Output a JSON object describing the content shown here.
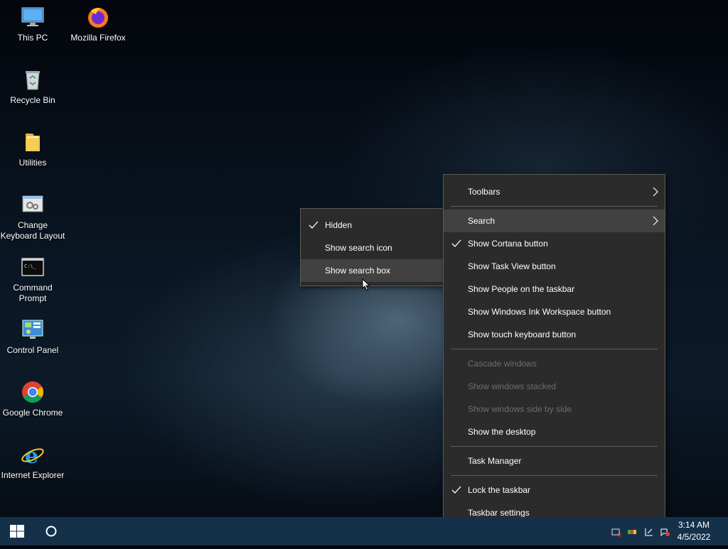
{
  "desktop": {
    "icons": [
      {
        "label_line1": "This PC",
        "label_line2": "",
        "icon": "this-pc-icon"
      },
      {
        "label_line1": "Mozilla Firefox",
        "label_line2": "",
        "icon": "firefox-icon"
      },
      {
        "label_line1": "Recycle Bin",
        "label_line2": "",
        "icon": "recycle-bin-icon"
      },
      {
        "label_line1": "Utilities",
        "label_line2": "",
        "icon": "folder-icon"
      },
      {
        "label_line1": "Change",
        "label_line2": "Keyboard Layout",
        "icon": "keyboard-layout-icon"
      },
      {
        "label_line1": "Command",
        "label_line2": "Prompt",
        "icon": "command-prompt-icon"
      },
      {
        "label_line1": "Control Panel",
        "label_line2": "",
        "icon": "control-panel-icon"
      },
      {
        "label_line1": "Google Chrome",
        "label_line2": "",
        "icon": "chrome-icon"
      },
      {
        "label_line1": "Internet Explorer",
        "label_line2": "",
        "icon": "internet-explorer-icon"
      }
    ]
  },
  "taskbar_menu": {
    "items": [
      {
        "label": "Toolbars",
        "checked": false,
        "submenu": true,
        "disabled": false
      },
      {
        "label": "Search",
        "checked": false,
        "submenu": true,
        "disabled": false,
        "highlighted": true
      },
      {
        "label": "Show Cortana button",
        "checked": true,
        "submenu": false,
        "disabled": false
      },
      {
        "label": "Show Task View button",
        "checked": false,
        "submenu": false,
        "disabled": false
      },
      {
        "label": "Show People on the taskbar",
        "checked": false,
        "submenu": false,
        "disabled": false
      },
      {
        "label": "Show Windows Ink Workspace button",
        "checked": false,
        "submenu": false,
        "disabled": false
      },
      {
        "label": "Show touch keyboard button",
        "checked": false,
        "submenu": false,
        "disabled": false
      },
      {
        "label": "Cascade windows",
        "checked": false,
        "submenu": false,
        "disabled": true
      },
      {
        "label": "Show windows stacked",
        "checked": false,
        "submenu": false,
        "disabled": true
      },
      {
        "label": "Show windows side by side",
        "checked": false,
        "submenu": false,
        "disabled": true
      },
      {
        "label": "Show the desktop",
        "checked": false,
        "submenu": false,
        "disabled": false
      },
      {
        "label": "Task Manager",
        "checked": false,
        "submenu": false,
        "disabled": false
      },
      {
        "label": "Lock the taskbar",
        "checked": true,
        "submenu": false,
        "disabled": false
      },
      {
        "label": "Taskbar settings",
        "checked": false,
        "submenu": false,
        "disabled": false
      }
    ]
  },
  "search_submenu": {
    "items": [
      {
        "label": "Hidden",
        "checked": true
      },
      {
        "label": "Show search icon",
        "checked": false
      },
      {
        "label": "Show search box",
        "checked": false,
        "highlighted": true
      }
    ]
  },
  "taskbar": {
    "start_icon": "windows-start-icon",
    "cortana_icon": "cortana-circle-icon",
    "time": "3:14 AM",
    "date": "4/5/2022",
    "tray_icons": [
      "network-icon",
      "volume-icon",
      "action-center-icon",
      "notification-icon"
    ]
  },
  "colors": {
    "taskbar_bg": "#15314a",
    "menu_bg": "#2b2b2b",
    "menu_highlight": "#414141",
    "menu_disabled_text": "#6d6d6d"
  }
}
